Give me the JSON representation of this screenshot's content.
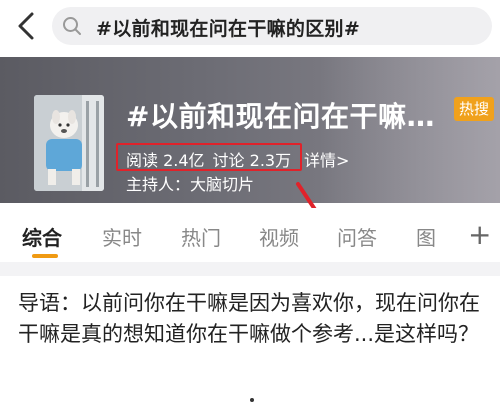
{
  "search": {
    "query": "#以前和现在问在干嘛的区别#"
  },
  "topic": {
    "title": "#以前和现在问在干嘛…",
    "badge": "热搜",
    "reads": "阅读 2.4亿",
    "discussions": "讨论 2.3万",
    "details": "详情>",
    "host": "主持人：大脑切片"
  },
  "tabs": [
    {
      "label": "综合"
    },
    {
      "label": "实时"
    },
    {
      "label": "热门"
    },
    {
      "label": "视频"
    },
    {
      "label": "问答"
    },
    {
      "label": "图"
    }
  ],
  "tab_plus": "+",
  "intro": {
    "text": "导语：以前问你在干嘛是因为喜欢你，现在问你在干嘛是真的想知道你在干嘛做个参考...是这样吗？"
  },
  "colors": {
    "accent": "#f09a12",
    "badge": "#f0a11c",
    "annotation": "#e0222a"
  }
}
